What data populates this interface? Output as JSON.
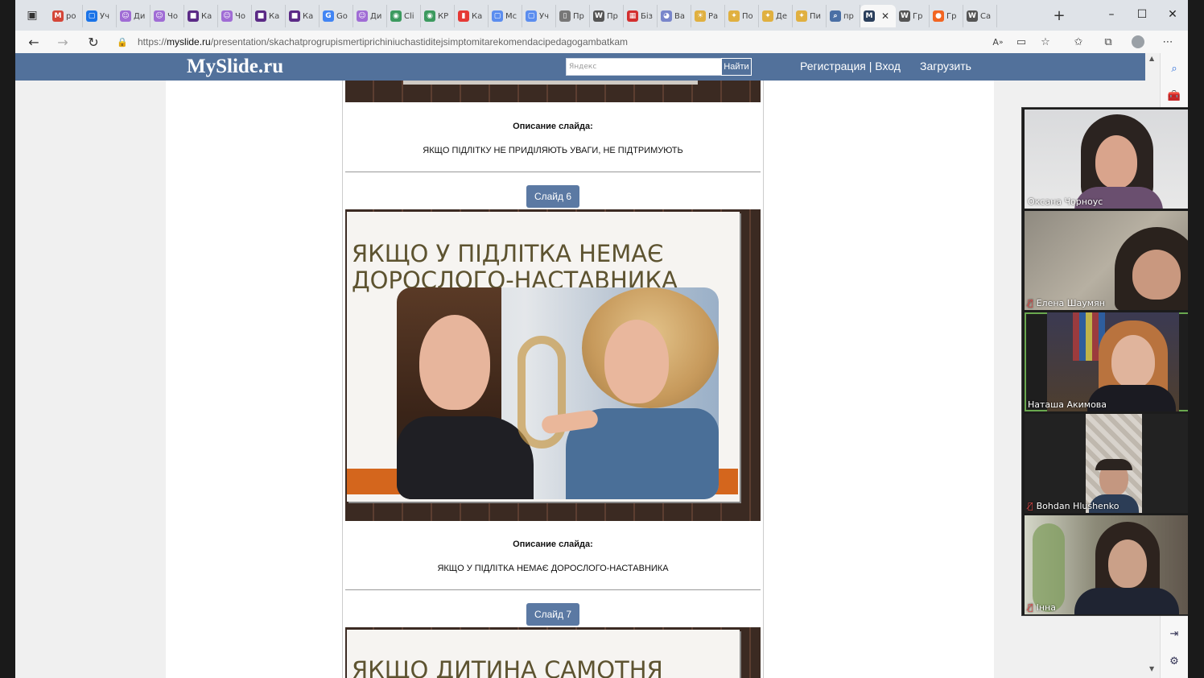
{
  "tabs": [
    {
      "label": "po",
      "icon": "gmail-icon",
      "color": "#d44638"
    },
    {
      "label": "Уч",
      "icon": "meet-icon",
      "color": "#1a73e8"
    },
    {
      "label": "Ди",
      "icon": "profile-icon",
      "color": "#a06cd5"
    },
    {
      "label": "Чо",
      "icon": "profile-icon",
      "color": "#a06cd5"
    },
    {
      "label": "Ка",
      "icon": "square-icon",
      "color": "#5b2a86"
    },
    {
      "label": "Чо",
      "icon": "profile-icon",
      "color": "#a06cd5"
    },
    {
      "label": "Ка",
      "icon": "square-icon",
      "color": "#5b2a86"
    },
    {
      "label": "Ка",
      "icon": "square-icon",
      "color": "#5b2a86"
    },
    {
      "label": "Go",
      "icon": "translate-icon",
      "color": "#4285f4"
    },
    {
      "label": "Ди",
      "icon": "profile-icon",
      "color": "#a06cd5"
    },
    {
      "label": "Cli",
      "icon": "globe-icon",
      "color": "#3c9a5f"
    },
    {
      "label": "КР",
      "icon": "globe-icon",
      "color": "#3c9a5f"
    },
    {
      "label": "Ка",
      "icon": "bars-icon",
      "color": "#e53935"
    },
    {
      "label": "Мс",
      "icon": "meet-icon",
      "color": "#5b8def"
    },
    {
      "label": "Уч",
      "icon": "meet-icon",
      "color": "#5b8def"
    },
    {
      "label": "Пр",
      "icon": "doc-icon",
      "color": "#777777"
    },
    {
      "label": "Пр",
      "icon": "wiki-icon",
      "color": "#555555"
    },
    {
      "label": "Біз",
      "icon": "grid-icon",
      "color": "#d32f2f"
    },
    {
      "label": "Ва",
      "icon": "face-icon",
      "color": "#7986cb"
    },
    {
      "label": "Ра",
      "icon": "sun-icon",
      "color": "#e0b040"
    },
    {
      "label": "По",
      "icon": "bulb-icon",
      "color": "#e0b040"
    },
    {
      "label": "Де",
      "icon": "bulb-icon",
      "color": "#e0b040"
    },
    {
      "label": "Пи",
      "icon": "bulb-icon",
      "color": "#e0b040"
    },
    {
      "label": "пр",
      "icon": "search-icon",
      "color": "#4a6fa5"
    },
    {
      "label": "",
      "icon": "myslide-icon",
      "color": "#2b3f5c",
      "active": true
    },
    {
      "label": "Гр",
      "icon": "wiki-icon",
      "color": "#555555"
    },
    {
      "label": "Гр",
      "icon": "orange-icon",
      "color": "#f26522"
    },
    {
      "label": "Са",
      "icon": "wiki-icon",
      "color": "#555555"
    }
  ],
  "address": {
    "scheme": "https://",
    "host": "myslide.ru",
    "path": "/presentation/skachatprogrupismertiprichiniuchastiditejsimptomitarekomendacipedagogambatkam"
  },
  "site": {
    "logo": "MySlide.ru",
    "search_placeholder": "Яндекс",
    "search_button": "Найти",
    "register": "Регистрация",
    "separator": "|",
    "login": "Вход",
    "upload": "Загрузить"
  },
  "slides": {
    "prev_desc_title": "Описание слайда:",
    "prev_desc_text": "ЯКЩО ПІДЛІТКУ НЕ ПРИДІЛЯЮТЬ УВАГИ, НЕ ПІДТРИМУЮТЬ",
    "slide6_button": "Слайд 6",
    "slide6_heading_1": "ЯКЩО У ПІДЛІТКА НЕМАЄ",
    "slide6_heading_2": "ДОРОСЛОГО-НАСТАВНИКА",
    "slide6_desc_title": "Описание слайда:",
    "slide6_desc_text": "ЯКЩО У ПІДЛІТКА НЕМАЄ ДОРОСЛОГО-НАСТАВНИКА",
    "slide7_button": "Слайд 7",
    "slide7_heading": "ЯКЩО ДИТИНА САМОТНЯ"
  },
  "participants": [
    {
      "name": "Оксана Чорноус",
      "muted": false,
      "active": false
    },
    {
      "name": "Елена Шаумян",
      "muted": true,
      "active": false
    },
    {
      "name": "Наташа Акимова",
      "muted": false,
      "active": true
    },
    {
      "name": "Bohdan Hlushenko",
      "muted": true,
      "active": false
    },
    {
      "name": "Інна",
      "muted": true,
      "active": false
    }
  ]
}
